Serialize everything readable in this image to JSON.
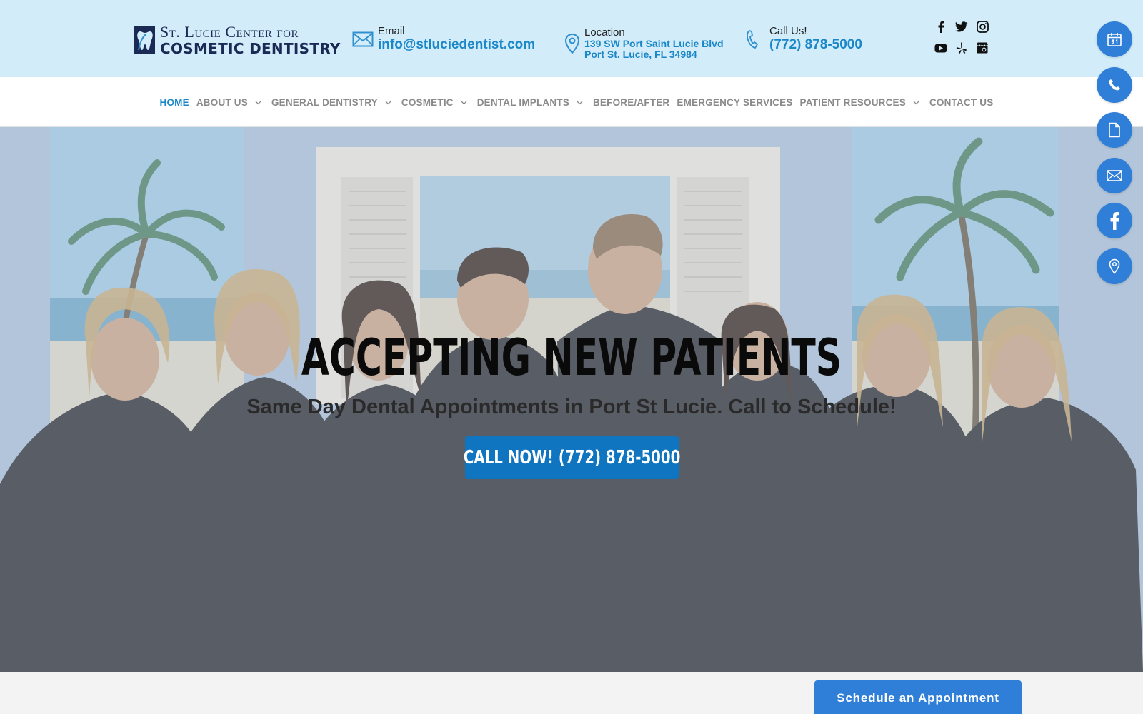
{
  "brand": {
    "line1": "St. Lucie Center for",
    "line2": "Cosmetic Dentistry"
  },
  "contact": {
    "email_label": "Email",
    "email_value": "info@stluciedentist.com",
    "location_label": "Location",
    "address_line1": "139 SW Port Saint Lucie Blvd",
    "address_line2": "Port St. Lucie, FL 34984",
    "call_label": "Call Us!",
    "phone": "(772) 878-5000"
  },
  "social": [
    "facebook-icon",
    "twitter-icon",
    "instagram-icon",
    "youtube-icon",
    "yelp-icon",
    "google-my-business-icon"
  ],
  "nav": {
    "items": [
      {
        "label": "HOME",
        "active": true,
        "dropdown": false
      },
      {
        "label": "ABOUT US",
        "active": false,
        "dropdown": true
      },
      {
        "label": "GENERAL DENTISTRY",
        "active": false,
        "dropdown": true
      },
      {
        "label": "COSMETIC",
        "active": false,
        "dropdown": true
      },
      {
        "label": "DENTAL IMPLANTS",
        "active": false,
        "dropdown": true
      },
      {
        "label": "BEFORE/AFTER",
        "active": false,
        "dropdown": false
      },
      {
        "label": "EMERGENCY SERVICES",
        "active": false,
        "dropdown": false
      },
      {
        "label": "PATIENT RESOURCES",
        "active": false,
        "dropdown": true
      },
      {
        "label": "CONTACT US",
        "active": false,
        "dropdown": false
      }
    ]
  },
  "hero": {
    "title": "ACCEPTING NEW PATIENTS",
    "subtitle": "Same Day Dental Appointments in Port St Lucie. Call to Schedule!",
    "cta": "CALL NOW! (772) 878-5000"
  },
  "floating_buttons": [
    "calendar-icon",
    "phone-icon",
    "document-icon",
    "mail-icon",
    "facebook-icon",
    "location-pin-icon"
  ],
  "schedule_button": "Schedule an Appointment",
  "colors": {
    "topbar_bg": "#d2ecfa",
    "accent_blue": "#1a87c9",
    "cta_blue": "#0f75c0",
    "float_blue": "#2f7ed8",
    "nav_text": "#8a8a8a"
  }
}
